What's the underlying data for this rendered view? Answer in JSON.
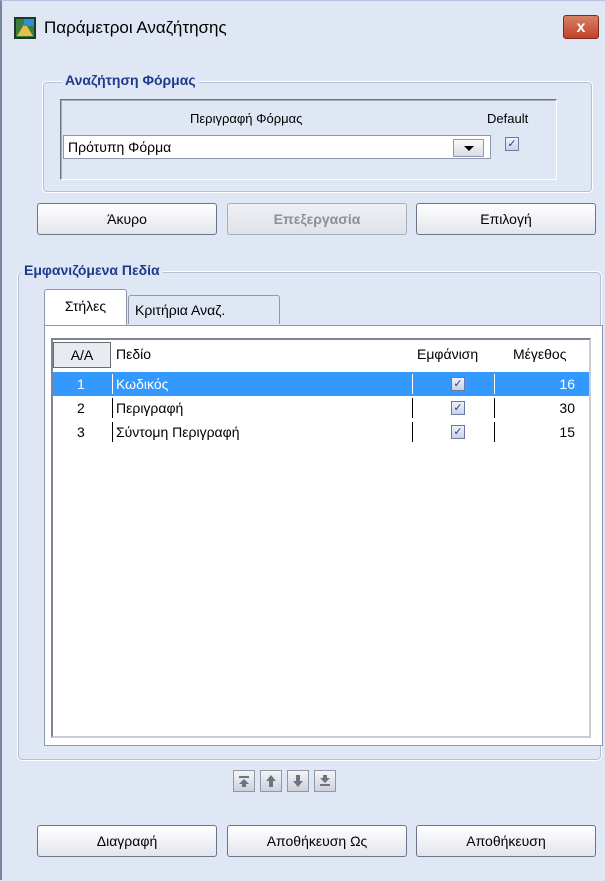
{
  "window": {
    "title": "Παράμετροι Αναζήτησης",
    "close_label": "x"
  },
  "form_search": {
    "legend": "Αναζήτηση Φόρμας",
    "col_description": "Περιγραφή Φόρμας",
    "col_default": "Default",
    "selected_form": "Πρότυπη Φόρμα",
    "default_checked": true
  },
  "actions_top": {
    "cancel": "Άκυρο",
    "edit": "Επεξεργασία",
    "select": "Επιλογή"
  },
  "fields": {
    "legend": "Εμφανιζόμενα Πεδία",
    "tabs": [
      {
        "label": "Στήλες",
        "active": true
      },
      {
        "label": "Κριτήρια Αναζ.",
        "active": false
      }
    ],
    "table": {
      "headers": [
        "Α/Α",
        "Πεδίο",
        "Εμφάνιση",
        "Μέγεθος"
      ],
      "rows": [
        {
          "num": "1",
          "field": "Κωδικός",
          "visible": true,
          "size": "16",
          "selected": true
        },
        {
          "num": "2",
          "field": "Περιγραφή",
          "visible": true,
          "size": "30",
          "selected": false
        },
        {
          "num": "3",
          "field": "Σύντομη Περιγραφή",
          "visible": true,
          "size": "15",
          "selected": false
        }
      ]
    },
    "order_buttons": [
      "move-top-icon",
      "move-up-icon",
      "move-down-icon",
      "move-bottom-icon"
    ]
  },
  "actions_bottom": {
    "delete": "Διαγραφή",
    "save_as": "Αποθήκευση Ως",
    "save": "Αποθήκευση"
  },
  "colors": {
    "accent": "#1f3a8a",
    "selection": "#3399ff",
    "close": "#c0432b"
  }
}
